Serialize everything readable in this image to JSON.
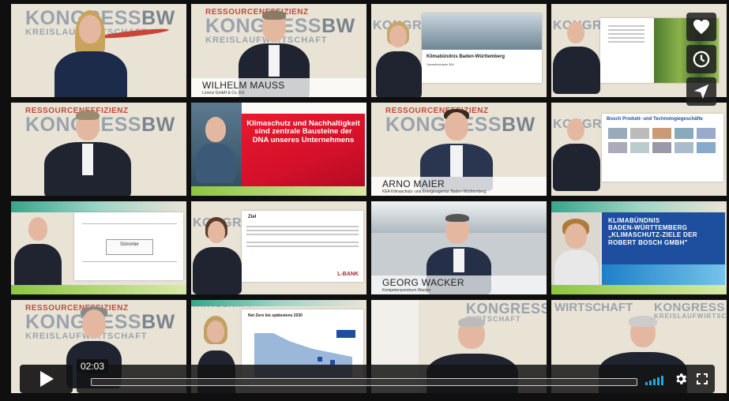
{
  "banner": {
    "line1": "RESSOURCENEFFIZIENZ",
    "line2a": "KONGRESS",
    "line2b": "BW",
    "line3": "KREISLAUFWIRTSCHAFT"
  },
  "tiles": {
    "t2_name": "WILHELM MAUSS",
    "t2_sub": "Lorenz GmbH & Co. KG",
    "t3_slide_title": "Klimabündnis Baden-Württemberg",
    "t3_slide_sub": "Umweltminister BW",
    "t6_slide_title": "Klimaschutz und Nachhaltigkeit sind zentrale Bausteine der DNA unseres Unternehmens",
    "t7_name": "ARNO MAIER",
    "t7_sub": "KEA Klimaschutz- und Energieagentur Baden-Württemberg",
    "t8_slide_title": "Bosch Produkt- und Technologiegeschäfte",
    "t10_slide_title": "Sömmler",
    "t11_slide_title": "Ziel",
    "t11_logo": "L-BANK",
    "t12_name": "GEORG WACKER",
    "t12_sub": "Kompetenzzentrum Wacker",
    "t13_slide_line1": "KLIMABÜNDNIS",
    "t13_slide_line2": "BADEN-WÜRTTEMBERG",
    "t13_slide_line3": "„KLIMASCHUTZ-ZIELE DER",
    "t13_slide_line4": "ROBERT BOSCH GMBH\"",
    "t15_slide_title": "Net Zero bis spätestens 2030",
    "t17_wall": "WIRTSCHAFT",
    "t18_wall": "WIRTSCHAFT"
  },
  "player": {
    "time": "02:03",
    "volume_color": "#19a9e5",
    "icons": [
      "heart-icon",
      "clock-icon",
      "send-icon",
      "play-icon",
      "volume-icon",
      "gear-icon",
      "fullscreen-icon"
    ]
  }
}
